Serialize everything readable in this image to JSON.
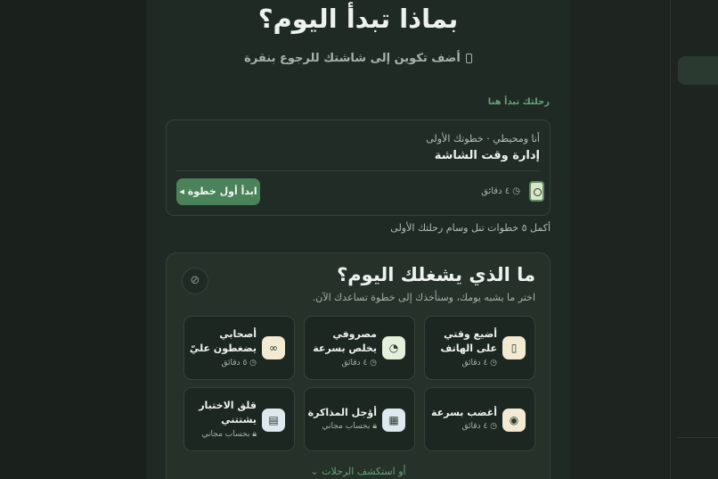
{
  "header": {
    "title": "بماذا تبدأ اليوم؟",
    "subtitle": "أضف تكوين إلى شاشتك للرجوع بنقرة"
  },
  "first_step": {
    "section_label": "رحلتك تبدأ هنا",
    "kicker": "أنا ومحيطي · خطوتك الأولى",
    "title": "إدارة وقت الشاشة",
    "duration": "٤ دقائق",
    "start_label": "ابدأ أول خطوة",
    "reward_note": "أكمل ٥ خطوات تنل وسام رحلتك الأولى"
  },
  "concerns": {
    "title": "ما الذي يشغلك اليوم؟",
    "subtitle": "اختر ما يشبه يومك، وسنأخذك إلى خطوة تساعدك الآن.",
    "items": [
      {
        "name": "أضيع وقتي على الهاتف",
        "meta": "٤ دقائق",
        "icon": "phone-icon",
        "icon_bg": "#f2ead2"
      },
      {
        "name": "مصروفي يخلص بسرعة",
        "meta": "٤ دقائق",
        "icon": "money-chart-icon",
        "icon_bg": "#e4f0da"
      },
      {
        "name": "أصحابي يضغطون عليّ",
        "meta": "٥ دقائق",
        "icon": "friends-icon",
        "icon_bg": "#f2ead2"
      },
      {
        "name": "أغضب بسرعة",
        "meta": "٤ دقائق",
        "icon": "anger-icon",
        "icon_bg": "#f2ead2"
      },
      {
        "name": "أؤجل المذاكرة",
        "meta": "بحساب مجاني",
        "icon": "calendar-icon",
        "icon_bg": "#dde8ef"
      },
      {
        "name": "قلق الاختبار يشتتني",
        "meta": "بحساب مجاني",
        "icon": "exam-icon",
        "icon_bg": "#dde8ef"
      }
    ]
  },
  "footer": {
    "explore_label": "أو استكشف الرحلات"
  }
}
